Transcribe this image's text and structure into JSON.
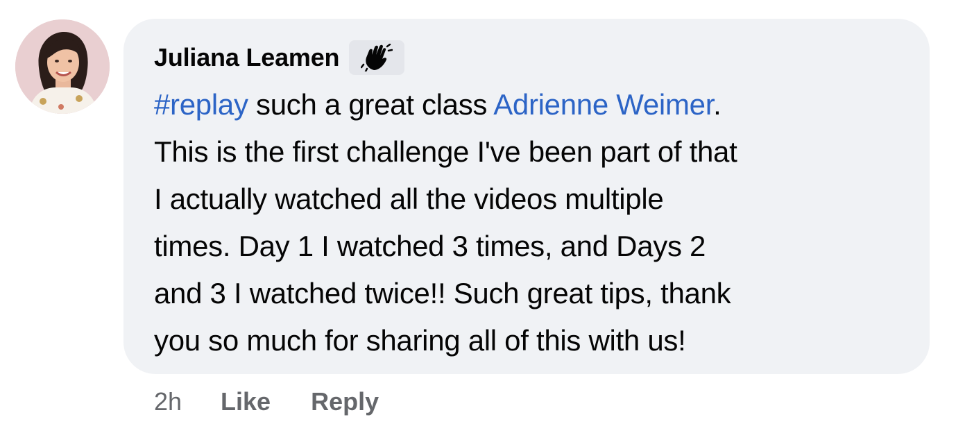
{
  "comment": {
    "author": "Juliana Leamen",
    "badge_icon": "waving-hand-icon",
    "text_lines": [
      {
        "segments": [
          {
            "text": "#replay",
            "type": "hashtag"
          },
          {
            "text": " such a great class ",
            "type": "plain"
          },
          {
            "text": "Adrienne Weimer",
            "type": "mention"
          },
          {
            "text": ".",
            "type": "plain"
          }
        ]
      },
      {
        "segments": [
          {
            "text": "This is the first challenge I've been part of that",
            "type": "plain"
          }
        ]
      },
      {
        "segments": [
          {
            "text": "I actually watched all the videos multiple",
            "type": "plain"
          }
        ]
      },
      {
        "segments": [
          {
            "text": "times. Day 1 I watched 3 times, and Days 2",
            "type": "plain"
          }
        ]
      },
      {
        "segments": [
          {
            "text": "and 3 I watched twice!! Such great tips, thank",
            "type": "plain"
          }
        ]
      },
      {
        "segments": [
          {
            "text": "you so much for sharing all of this with us!",
            "type": "plain"
          }
        ]
      }
    ],
    "timestamp": "2h",
    "like_label": "Like",
    "reply_label": "Reply"
  },
  "colors": {
    "bubble_bg": "#f0f2f5",
    "link": "#2c64c6",
    "text": "#050505",
    "meta": "#65676b"
  }
}
